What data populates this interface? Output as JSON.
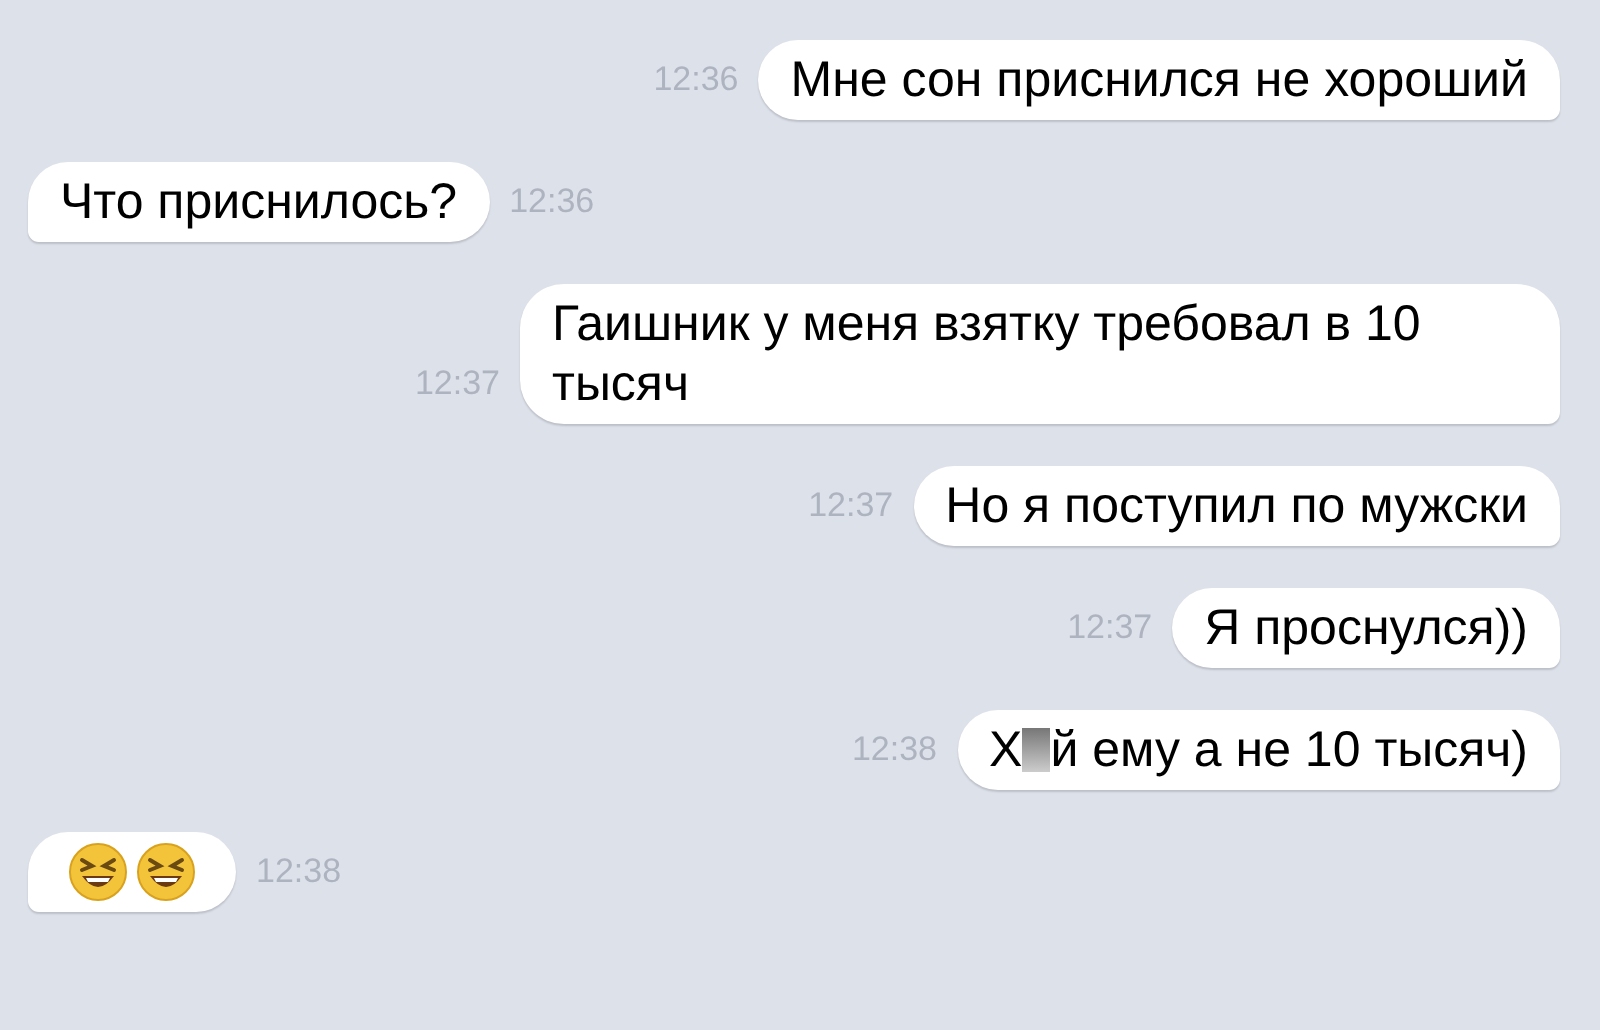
{
  "messages": [
    {
      "outgoing": true,
      "kind": "text",
      "text": "Мне сон приснился не хороший",
      "time": "12:36"
    },
    {
      "outgoing": false,
      "kind": "text",
      "text": "Что приснилось?",
      "time": "12:36"
    },
    {
      "outgoing": true,
      "kind": "text",
      "text": "Гаишник у меня взятку требовал в 10 тысяч",
      "time": "12:37"
    },
    {
      "outgoing": true,
      "kind": "text",
      "text": "Но я поступил по мужски",
      "time": "12:37"
    },
    {
      "outgoing": true,
      "kind": "text",
      "text": "Я проснулся))",
      "time": "12:37"
    },
    {
      "outgoing": true,
      "kind": "censored",
      "text_before": "Х",
      "text_after": "й ему а не 10 тысяч)",
      "time": "12:38"
    },
    {
      "outgoing": false,
      "kind": "emoji",
      "time": "12:38"
    }
  ]
}
